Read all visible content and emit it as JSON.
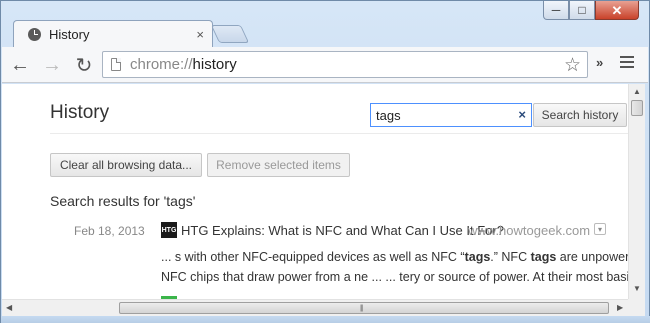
{
  "window": {
    "minimize_glyph": "─",
    "maximize_glyph": "□",
    "close_glyph": "✕"
  },
  "tab": {
    "title": "History",
    "close_glyph": "×",
    "icon": "history-clock-icon"
  },
  "toolbar": {
    "back_glyph": "←",
    "forward_glyph": "→",
    "reload_glyph": "↻",
    "url_scheme": "chrome://",
    "url_path": "history",
    "star_glyph": "☆",
    "overflow_glyph": "»"
  },
  "page": {
    "title": "History",
    "search_value": "tags",
    "search_clear_glyph": "×",
    "search_button": "Search history",
    "clear_all_button": "Clear all browsing data...",
    "remove_selected_button": "Remove selected items",
    "results_heading": "Search results for 'tags'"
  },
  "results": [
    {
      "date": "Feb 18, 2013",
      "favicon_text": "HTG",
      "title": "HTG Explains: What is NFC and What Can I Use It For?",
      "domain": "www.howtogeek.com",
      "dropdown_glyph": "▾",
      "snippet_line1": {
        "part1": "... s with other NFC-equipped devices as well as NFC “",
        "bold1": "tags",
        "part2": ".” NFC ",
        "bold2": "tags",
        "part3": " are unpowered"
      },
      "snippet_line2": "NFC chips that draw power from a ne ... ... tery or source of power. At their most basic,..."
    }
  ],
  "scrollbars": {
    "up_glyph": "▲",
    "down_glyph": "▼",
    "left_glyph": "◀",
    "right_glyph": "▶",
    "grip_glyph": "|||"
  },
  "colors": {
    "accent_focus": "#4d90fe",
    "window_frame": "#c5daf1",
    "close_button": "#c9422a"
  }
}
